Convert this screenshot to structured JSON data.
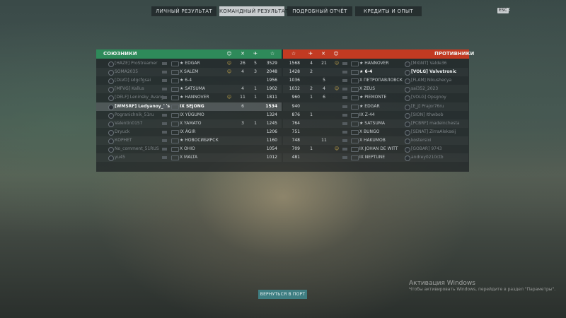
{
  "tabs": [
    {
      "label": "ЛИЧНЫЙ РЕЗУЛЬТАТ",
      "active": false
    },
    {
      "label": "КОМАНДНЫЙ РЕЗУЛЬТАТ",
      "active": true
    },
    {
      "label": "ПОДРОБНЫЙ ОТЧЁТ",
      "active": false
    },
    {
      "label": "КРЕДИТЫ И ОПЫТ",
      "active": false
    }
  ],
  "esc_label": "ESC",
  "close_glyph": "✕",
  "allies_title": "СОЮЗНИКИ",
  "enemies_title": "ПРОТИВНИКИ",
  "column_icons": {
    "ribbon": "☺",
    "frag": "✕",
    "plane": "✈",
    "xp": "☆"
  },
  "allies": [
    {
      "player": "[HAZE] ProStreamer",
      "ship": "★ EDGAR",
      "ribbon": "☺",
      "kills": "26",
      "planes": "5",
      "xp": "3529"
    },
    {
      "player": "SOMA2035",
      "ship": "X SALEM",
      "ribbon": "☺",
      "kills": "4",
      "planes": "3",
      "xp": "2048"
    },
    {
      "player": "[DLVD] sdgcfgsai",
      "ship": "★ 6-4",
      "ribbon": "",
      "kills": "",
      "planes": "",
      "xp": "1956"
    },
    {
      "player": "[MFVG] Kallus",
      "ship": "★ SATSUMA",
      "ribbon": "",
      "kills": "4",
      "planes": "1",
      "xp": "1902"
    },
    {
      "player": "[DELF] Leninsky_Avang",
      "ship": "★ HANNOVER",
      "ribbon": "☺",
      "kills": "11",
      "planes": "1",
      "xp": "1811"
    },
    {
      "player": "[WMSRF] Ledyanoy_Lis",
      "ship": "IX SEJONG",
      "ribbon": "",
      "kills": "6",
      "planes": "",
      "xp": "1534",
      "me": true
    },
    {
      "player": "Pogranichnik_51ru",
      "ship": "IX YŪGUMO",
      "ribbon": "",
      "kills": "",
      "planes": "",
      "xp": "1324"
    },
    {
      "player": "Valentin0157",
      "ship": "X YAMATO",
      "ribbon": "",
      "kills": "3",
      "planes": "1",
      "xp": "1245"
    },
    {
      "player": "Dryuck",
      "ship": "IX ÄGIR",
      "ribbon": "",
      "kills": "",
      "planes": "",
      "xp": "1206"
    },
    {
      "player": "КОРНЕТ",
      "ship": "★ НОВОСИБИРСК",
      "ribbon": "",
      "kills": "",
      "planes": "",
      "xp": "1160"
    },
    {
      "player": "No_comment_51RUS",
      "ship": "X OHIO",
      "ribbon": "",
      "kills": "",
      "planes": "",
      "xp": "1054"
    },
    {
      "player": "yu45",
      "ship": "X MALTA",
      "ribbon": "",
      "kills": "",
      "planes": "",
      "xp": "1012"
    }
  ],
  "enemies": [
    {
      "xp": "1568",
      "kills": "4",
      "planes": "21",
      "ribbon": "☺",
      "ship": "★ HANNOVER",
      "player": "[MIGNT] Valde36"
    },
    {
      "xp": "1428",
      "kills": "2",
      "planes": "",
      "ribbon": "",
      "ship": "★ 6-4",
      "player": "[VOLG] Valvetronic",
      "bright": true
    },
    {
      "xp": "1036",
      "kills": "",
      "planes": "5",
      "ribbon": "",
      "ship": "X ПЕТРОПАВЛОВСК",
      "player": "[FLAM] Nikushecya"
    },
    {
      "xp": "1032",
      "kills": "2",
      "planes": "4",
      "ribbon": "☺",
      "ship": "X ZEUS",
      "player": "sai352_2023"
    },
    {
      "xp": "960",
      "kills": "1",
      "planes": "6",
      "ribbon": "",
      "ship": "★ PIEMONTE",
      "player": "[VOLG] Opsgnoy"
    },
    {
      "xp": "940",
      "kills": "",
      "planes": "",
      "ribbon": "",
      "ship": "★ EDGAR",
      "player": "[E_J] Prajor76ru"
    },
    {
      "xp": "876",
      "kills": "1",
      "planes": "",
      "ribbon": "",
      "ship": "IX Z-44",
      "player": "[SION] Ithwbob"
    },
    {
      "xp": "764",
      "kills": "",
      "planes": "",
      "ribbon": "",
      "ship": "★ SATSUMA",
      "player": "[PCBRF] madeinchesta"
    },
    {
      "xp": "751",
      "kills": "",
      "planes": "",
      "ribbon": "",
      "ship": "X BUNGO",
      "player": "[SENAT] ZirraAlekseij"
    },
    {
      "xp": "748",
      "kills": "",
      "planes": "11",
      "ribbon": "",
      "ship": "X HAKUMOB",
      "player": "kostersixi"
    },
    {
      "xp": "709",
      "kills": "1",
      "planes": "",
      "ribbon": "☺",
      "ship": "IX JOHAN DE WITT",
      "player": "[GOBAR] 9743"
    },
    {
      "xp": "481",
      "kills": "",
      "planes": "",
      "ribbon": "",
      "ship": "IX NEPTUNE",
      "player": "andrey0210ctb"
    }
  ],
  "return_button": "ВЕРНУТЬСЯ В ПОРТ",
  "watermark": {
    "title": "Активация Windows",
    "subtitle": "Чтобы активировать Windows, перейдите в раздел \"Параметры\"."
  }
}
